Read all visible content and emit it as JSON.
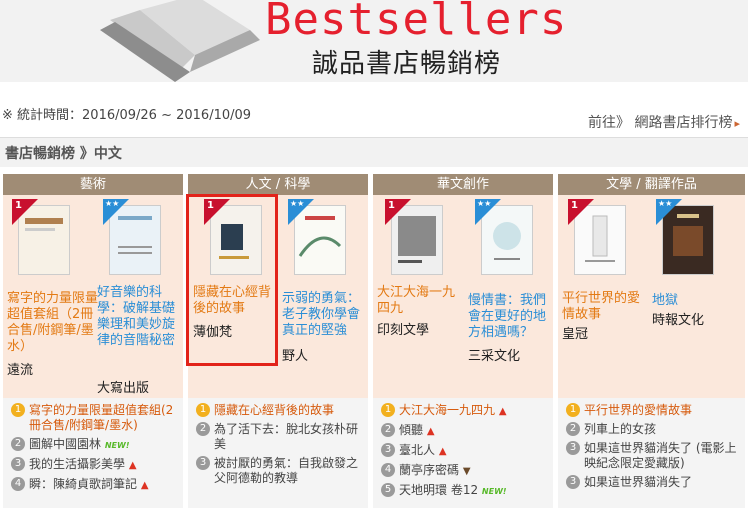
{
  "banner": {
    "title": "Bestsellers",
    "subtitle": "誠品書店暢銷榜"
  },
  "stats": {
    "label": "※ 統計時間：2016/09/26 ~ 2016/10/09"
  },
  "goto": {
    "label": "前往》 網路書店排行榜",
    "arrow": "▸"
  },
  "section": {
    "title": "書店暢銷榜 》中文"
  },
  "columns": [
    {
      "category": "藝術",
      "top1": {
        "rank": "1",
        "title": "寫字的力量限量超值套組（2冊合售/附鋼筆/墨水）",
        "publisher": "遠流"
      },
      "pick": {
        "tag": "★★",
        "title": "好音樂的科學：破解基礎樂理和美妙旋律的音階秘密",
        "publisher": "大寫出版"
      },
      "list": [
        {
          "num": "1",
          "text": "寫字的力量限量超值套組(2冊合售/附鋼筆/墨水)",
          "badge": ""
        },
        {
          "num": "2",
          "text": "圖解中國園林",
          "badge": "NEW!"
        },
        {
          "num": "3",
          "text": "我的生活攝影美學",
          "badge": "▲"
        },
        {
          "num": "4",
          "text": "瞬：陳綺貞歌詞筆記",
          "badge": "▲"
        }
      ]
    },
    {
      "category": "人文 / 科學",
      "top1": {
        "rank": "1",
        "title": "隱藏在心經背後的故事",
        "publisher": "薄伽梵"
      },
      "pick": {
        "tag": "★★",
        "title": "示弱的勇氣：老子教你學會真正的堅強",
        "publisher": "野人"
      },
      "list": [
        {
          "num": "1",
          "text": "隱藏在心經背後的故事",
          "badge": ""
        },
        {
          "num": "2",
          "text": "為了活下去：脫北女孩朴研美",
          "badge": ""
        },
        {
          "num": "3",
          "text": "被討厭的勇氣：自我啟發之父阿德勒的教導",
          "badge": ""
        }
      ]
    },
    {
      "category": "華文創作",
      "top1": {
        "rank": "1",
        "title": "大江大海一九四九",
        "publisher": "印刻文學"
      },
      "pick": {
        "tag": "★★",
        "title": "慢情書：我們會在更好的地方相遇嗎？",
        "publisher": "三采文化"
      },
      "list": [
        {
          "num": "1",
          "text": "大江大海一九四九",
          "badge": "▲"
        },
        {
          "num": "2",
          "text": "傾聽",
          "badge": "▲"
        },
        {
          "num": "3",
          "text": "臺北人",
          "badge": "▲"
        },
        {
          "num": "4",
          "text": "蘭亭序密碼",
          "badge": "▼"
        },
        {
          "num": "5",
          "text": "天地明環 卷12",
          "badge": "NEW!"
        }
      ]
    },
    {
      "category": "文學 / 翻譯作品",
      "top1": {
        "rank": "1",
        "title": "平行世界的愛情故事",
        "publisher": "皇冠"
      },
      "pick": {
        "tag": "★★",
        "title": "地獄",
        "publisher": "時報文化"
      },
      "list": [
        {
          "num": "1",
          "text": "平行世界的愛情故事",
          "badge": ""
        },
        {
          "num": "2",
          "text": "列車上的女孩",
          "badge": ""
        },
        {
          "num": "3",
          "text": "如果這世界貓消失了 (電影上映紀念限定愛藏版)",
          "badge": ""
        },
        {
          "num": "3",
          "text": "如果這世界貓消失了",
          "badge": ""
        }
      ]
    }
  ],
  "colors": {
    "accent": "#e5202e",
    "header": "#a08c75",
    "top_bg": "#fbe8dc",
    "list_bg": "#f4f4f4",
    "orange": "#e37a14",
    "blue": "#2a8ed6"
  }
}
